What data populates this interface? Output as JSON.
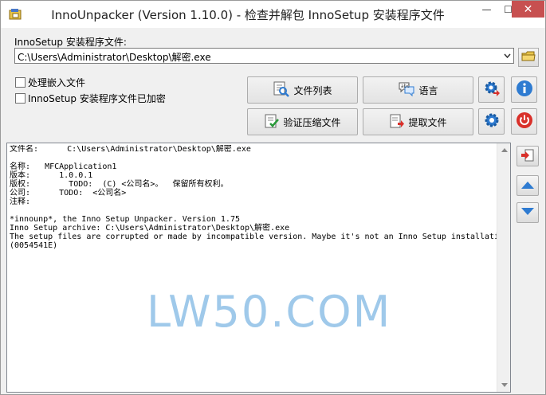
{
  "window": {
    "title": "InnoUnpacker (Version 1.10.0) - 检查并解包 InnoSetup 安装程序文件",
    "min_glyph": "—",
    "max_glyph": "☐",
    "close_glyph": "✕"
  },
  "installer": {
    "label": "InnoSetup 安装程序文件:",
    "path": "C:\\Users\\Administrator\\Desktop\\解密.exe"
  },
  "options": {
    "process_embedded": "处理嵌入文件",
    "encrypted": "InnoSetup 安装程序文件已加密"
  },
  "buttons": {
    "file_list": "文件列表",
    "language": "语言",
    "verify": "验证压缩文件",
    "extract": "提取文件"
  },
  "log": {
    "text": "文件名:      C:\\Users\\Administrator\\Desktop\\解密.exe\n\n名称:   MFCApplication1\n版本:      1.0.0.1\n版权:        TODO:  (C) <公司名>。  保留所有权利。\n公司:      TODO:  <公司名>\n注释:\n\n*innounp*, the Inno Setup Unpacker. Version 1.75\nInno Setup archive: C:\\Users\\Administrator\\Desktop\\解密.exe\nThe setup files are corrupted or made by incompatible version. Maybe it's not an Inno Setup installation at all.\n(0054541E)"
  },
  "watermark": "LW50.COM",
  "icons": [
    "app-icon",
    "dropdown-arrow-icon",
    "folder-icon",
    "file-list-icon",
    "language-icon",
    "verify-icon",
    "extract-icon",
    "settings-gear-icon",
    "info-icon",
    "settings-gear-icon",
    "power-icon",
    "open-log-icon",
    "up-arrow-icon",
    "down-arrow-icon"
  ],
  "colors": {
    "accent_blue": "#2e7bd1",
    "close_red": "#c75050",
    "power_red": "#d9302a",
    "watermark": "#7fb7e4"
  }
}
